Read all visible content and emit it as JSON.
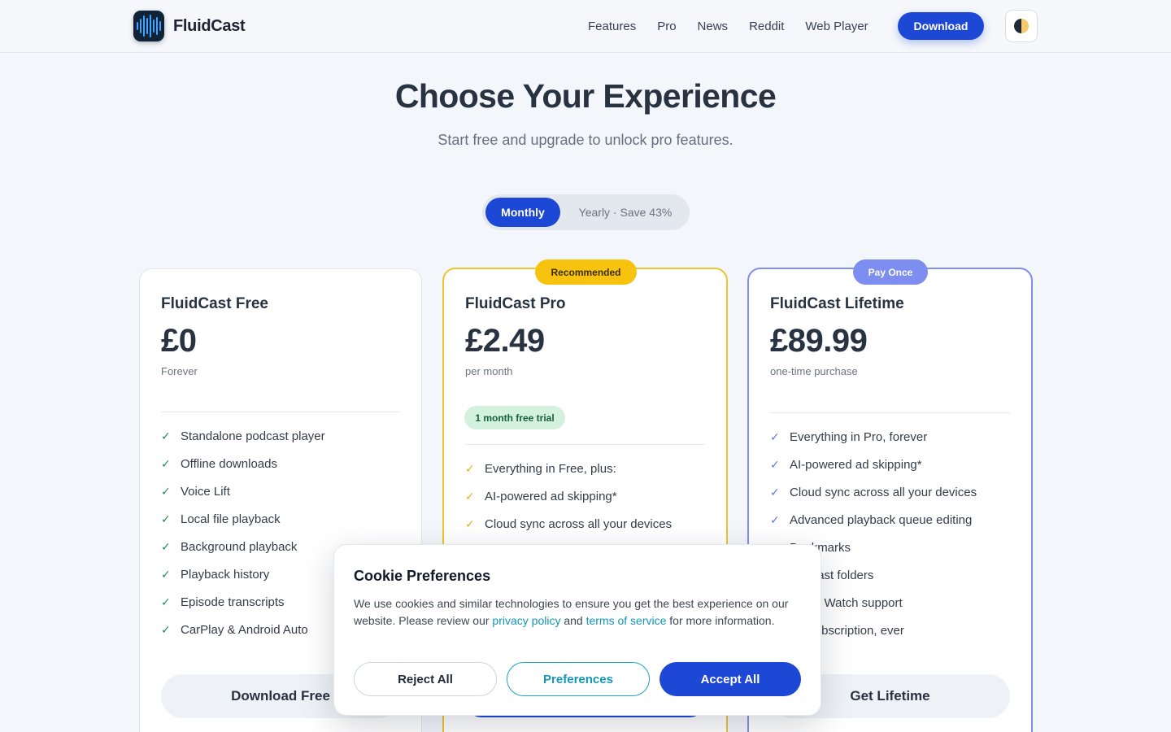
{
  "header": {
    "brand": "FluidCast",
    "nav": [
      "Features",
      "Pro",
      "News",
      "Reddit",
      "Web Player"
    ],
    "download_label": "Download",
    "theme_icon": "half-circle-theme-icon"
  },
  "hero": {
    "title": "Choose Your Experience",
    "subtitle": "Start free and upgrade to unlock pro features."
  },
  "billing": {
    "monthly": "Monthly",
    "yearly": "Yearly · Save 43%",
    "selected": "Monthly"
  },
  "plans": {
    "free": {
      "name": "FluidCast Free",
      "price": "£0",
      "period": "Forever",
      "features": [
        "Standalone podcast player",
        "Offline downloads",
        "Voice Lift",
        "Local file playback",
        "Background playback",
        "Playback history",
        "Episode transcripts",
        "CarPlay & Android Auto"
      ],
      "button": "Download Free"
    },
    "pro": {
      "badge": "Recommended",
      "name": "FluidCast Pro",
      "price": "£2.49",
      "period": "per month",
      "trial": "1 month free trial",
      "features": [
        "Everything in Free, plus:",
        "AI-powered ad skipping*",
        "Cloud sync across all your devices"
      ]
    },
    "lifetime": {
      "badge": "Pay Once",
      "name": "FluidCast Lifetime",
      "price": "£89.99",
      "period": "one-time purchase",
      "features": [
        "Everything in Pro, forever",
        "AI-powered ad skipping*",
        "Cloud sync across all your devices",
        "Advanced playback queue editing",
        "Bookmarks",
        "Podcast folders",
        "Apple Watch support",
        "No subscription, ever"
      ],
      "button": "Get Lifetime"
    }
  },
  "cookie": {
    "title": "Cookie Preferences",
    "text_before": "We use cookies and similar technologies to ensure you get the best experience on our website. Please review our ",
    "privacy_link": "privacy policy",
    "text_and": " and ",
    "terms_link": "terms of service",
    "text_after": " for more information.",
    "reject": "Reject All",
    "preferences": "Preferences",
    "accept": "Accept All"
  },
  "colors": {
    "primary": "#1d48d6",
    "pro_border": "#f2c230",
    "lifetime_border": "#7f8ff0",
    "check_free": "#1f8c52",
    "check_pro": "#f2a91b",
    "check_lifetime": "#6073dd"
  }
}
